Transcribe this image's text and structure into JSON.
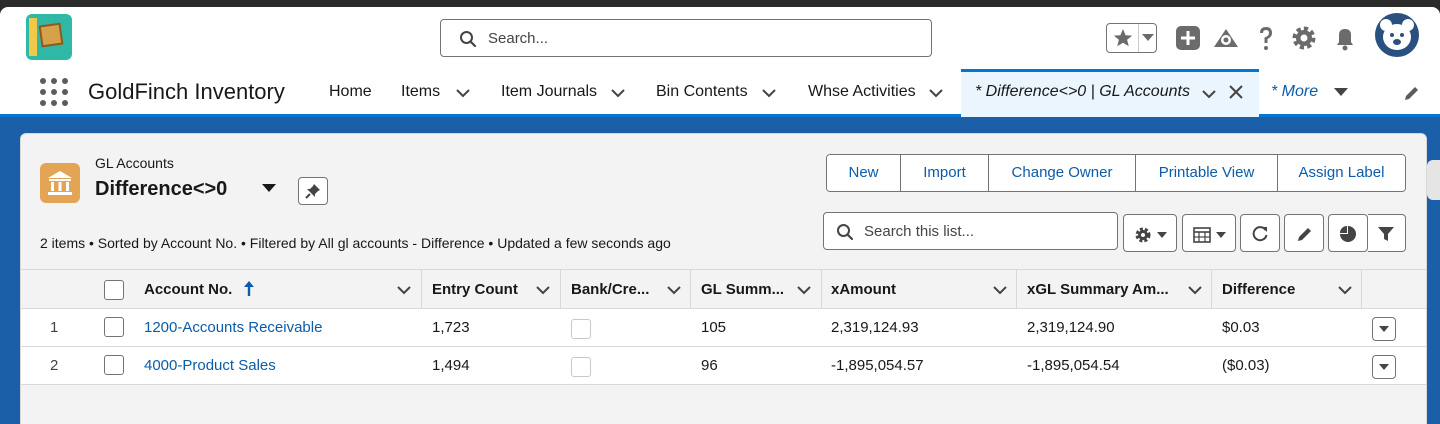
{
  "header": {
    "search_placeholder": "Search...",
    "icons": [
      "favorites-star-icon",
      "add-icon",
      "trailhead-icon",
      "help-icon",
      "setup-gear-icon",
      "notifications-bell-icon",
      "user-avatar"
    ]
  },
  "nav": {
    "app_name": "GoldFinch Inventory",
    "items": [
      {
        "label": "Home",
        "has_menu": false
      },
      {
        "label": "Items",
        "has_menu": true
      },
      {
        "label": "Item Journals",
        "has_menu": true
      },
      {
        "label": "Bin Contents",
        "has_menu": true
      },
      {
        "label": "Whse Activities",
        "has_menu": true
      }
    ],
    "active_tab": "* Difference<>0 | GL Accounts",
    "more": "* More"
  },
  "list_view": {
    "object_label": "GL Accounts",
    "title": "Difference<>0",
    "buttons": [
      "New",
      "Import",
      "Change Owner",
      "Printable View",
      "Assign Label"
    ],
    "search_placeholder": "Search this list...",
    "meta": "2 items • Sorted by Account No. • Filtered by All gl accounts - Difference • Updated a few seconds ago"
  },
  "table": {
    "columns": [
      "Account No.",
      "Entry Count",
      "Bank/Cre...",
      "GL Summ...",
      "xAmount",
      "xGL Summary Am...",
      "Difference"
    ],
    "rows": [
      {
        "num": "1",
        "account": "1200-Accounts Receivable",
        "entry_count": "1,723",
        "bank_checked": false,
        "gl_summ": "105",
        "xamount": "2,319,124.93",
        "xgl_summary": "2,319,124.90",
        "difference": "$0.03"
      },
      {
        "num": "2",
        "account": "4000-Product Sales",
        "entry_count": "1,494",
        "bank_checked": false,
        "gl_summ": "96",
        "xamount": "-1,895,054.57",
        "xgl_summary": "-1,895,054.54",
        "difference": "($0.03)"
      }
    ]
  },
  "colors": {
    "brand_blue": "#0176d3",
    "link": "#0b5cab",
    "background": "#1b5fa8",
    "object_icon": "#e3a454"
  }
}
